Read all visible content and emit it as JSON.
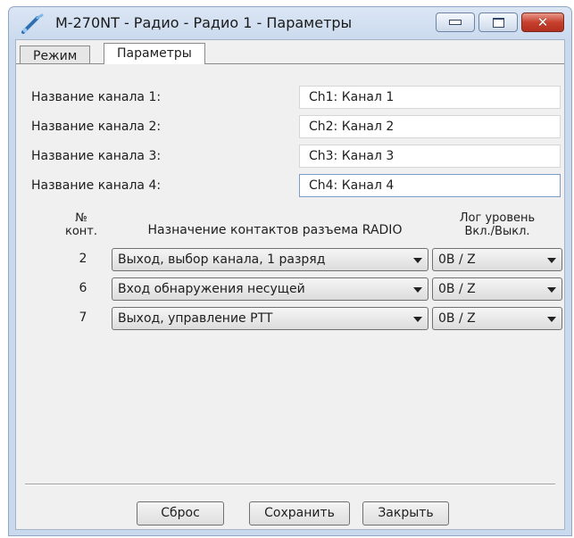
{
  "window": {
    "title": "M-270NT - Радио - Радио 1 - Параметры",
    "buttons": {
      "minimize": "minimize",
      "maximize": "maximize",
      "close": "✕"
    }
  },
  "tabs": [
    {
      "label": "Режим",
      "active": false
    },
    {
      "label": "Параметры",
      "active": true
    }
  ],
  "channels": [
    {
      "label": "Название канала 1:",
      "value": "Ch1: Канал 1"
    },
    {
      "label": "Название канала 2:",
      "value": "Ch2: Канал 2"
    },
    {
      "label": "Название канала 3:",
      "value": "Ch3: Канал 3"
    },
    {
      "label": "Название канала 4:",
      "value": "Ch4: Канал 4"
    }
  ],
  "table": {
    "headers": {
      "contact_line1": "№",
      "contact_line2": "конт.",
      "assignment": "Назначение контактов разъема RADIO",
      "level_line1": "Лог уровень",
      "level_line2": "Вкл./Выкл."
    },
    "rows": [
      {
        "contact": "2",
        "assignment": "Выход, выбор канала, 1 разряд",
        "level": "0В / Z"
      },
      {
        "contact": "6",
        "assignment": "Вход обнаружения несущей",
        "level": "0В / Z"
      },
      {
        "contact": "7",
        "assignment": "Выход, управление PTT",
        "level": "0В / Z"
      }
    ]
  },
  "footer": {
    "reset": "Сброс",
    "save": "Сохранить",
    "close": "Закрыть"
  }
}
